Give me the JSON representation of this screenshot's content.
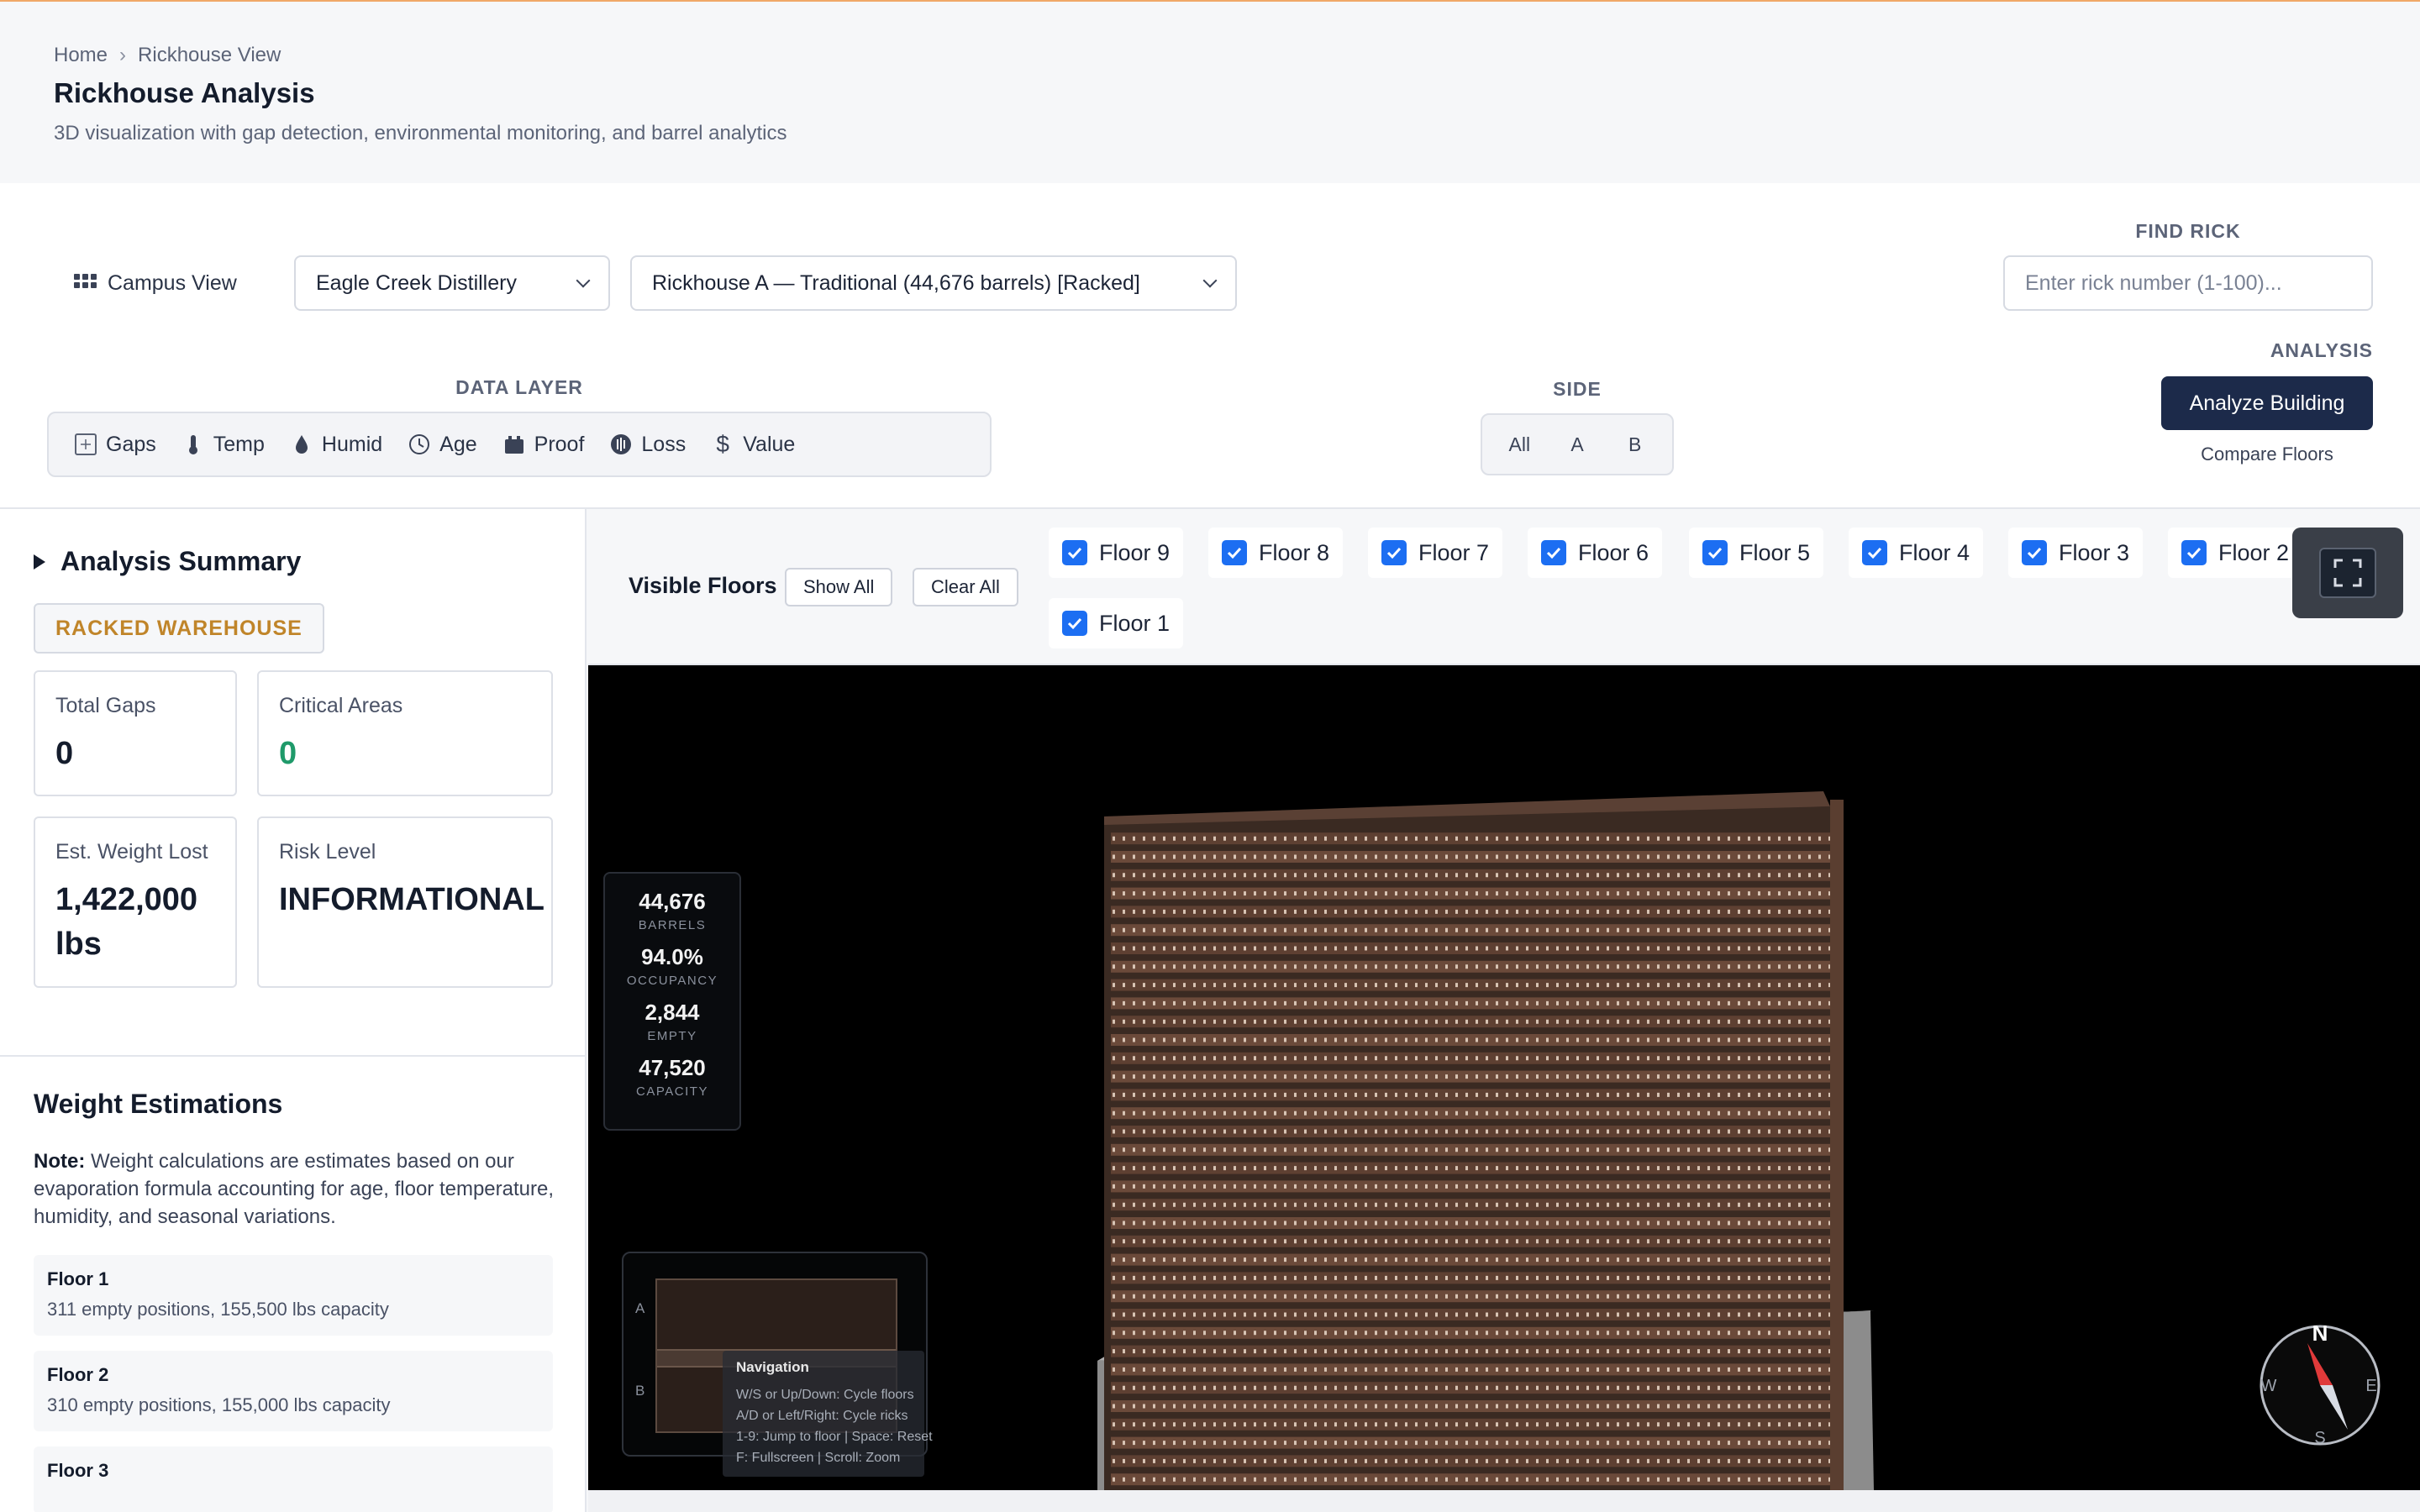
{
  "breadcrumb": {
    "home": "Home",
    "separator": "›",
    "current": "Rickhouse View"
  },
  "page": {
    "title": "Rickhouse Analysis",
    "subtitle": "3D visualization with gap detection, environmental monitoring, and barrel analytics"
  },
  "controls": {
    "campus_view": "Campus View",
    "distillery_select": "Eagle Creek Distillery",
    "rickhouse_select": "Rickhouse A — Traditional (44,676 barrels) [Racked]",
    "find_rick_label": "FIND RICK",
    "find_rick_placeholder": "Enter rick number (1-100)...",
    "analysis_label": "ANALYSIS",
    "analyze_button": "Analyze Building",
    "compare_link": "Compare Floors",
    "data_layer_label": "DATA LAYER",
    "data_layers": [
      {
        "label": "Gaps",
        "icon": "gaps-icon"
      },
      {
        "label": "Temp",
        "icon": "thermometer-icon"
      },
      {
        "label": "Humid",
        "icon": "droplet-icon"
      },
      {
        "label": "Age",
        "icon": "clock-icon"
      },
      {
        "label": "Proof",
        "icon": "flask-icon"
      },
      {
        "label": "Loss",
        "icon": "pie-chart-icon"
      },
      {
        "label": "Value",
        "icon": "dollar-icon"
      }
    ],
    "side_label": "SIDE",
    "side_options": [
      "All",
      "A",
      "B"
    ]
  },
  "summary": {
    "title": "Analysis Summary",
    "badge": "RACKED WAREHOUSE",
    "total_gaps_label": "Total Gaps",
    "total_gaps_value": "0",
    "critical_areas_label": "Critical Areas",
    "critical_areas_value": "0",
    "weight_lost_label": "Est. Weight Lost",
    "weight_lost_value": "1,422,000 lbs",
    "risk_level_label": "Risk Level",
    "risk_level_value": "INFORMATIONAL"
  },
  "weight": {
    "title": "Weight Estimations",
    "note_bold": "Note:",
    "note_text": " Weight calculations are estimates based on our evaporation formula accounting for age, floor temperature, humidity, and seasonal variations.",
    "floors": [
      {
        "name": "Floor 1",
        "detail": "311 empty positions, 155,500 lbs capacity"
      },
      {
        "name": "Floor 2",
        "detail": "310 empty positions, 155,000 lbs capacity"
      },
      {
        "name": "Floor 3",
        "detail": ""
      }
    ]
  },
  "floors_bar": {
    "label": "Visible Floors",
    "show_all": "Show All",
    "clear_all": "Clear All",
    "floors": [
      "Floor 9",
      "Floor 8",
      "Floor 7",
      "Floor 6",
      "Floor 5",
      "Floor 4",
      "Floor 3",
      "Floor 2",
      "Floor 1"
    ]
  },
  "viewport": {
    "stats": [
      {
        "value": "44,676",
        "caption": "BARRELS"
      },
      {
        "value": "94.0%",
        "caption": "OCCUPANCY"
      },
      {
        "value": "2,844",
        "caption": "EMPTY"
      },
      {
        "value": "47,520",
        "caption": "CAPACITY"
      }
    ],
    "minimap": {
      "side_a": "A",
      "side_b": "B"
    },
    "nav_help": {
      "title": "Navigation",
      "lines": [
        "W/S or Up/Down: Cycle floors",
        "A/D or Left/Right: Cycle ricks",
        "1-9: Jump to floor | Space: Reset",
        "F: Fullscreen | Scroll: Zoom"
      ]
    },
    "compass": {
      "n": "N",
      "s": "S",
      "e": "E",
      "w": "W"
    }
  },
  "colors": {
    "accent_navy": "#1c2a4a",
    "badge_amber": "#c0852a",
    "success_green": "#1f9a6a",
    "checkbox_blue": "#1c6ef2",
    "barrel_wood": "#8a6248"
  }
}
